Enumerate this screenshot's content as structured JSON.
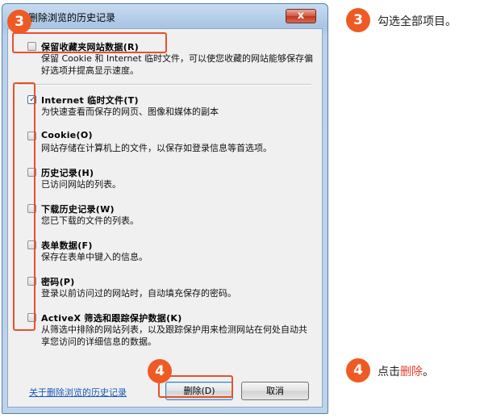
{
  "dialog": {
    "title": "删除浏览的历史记录",
    "close_label": "x",
    "items": [
      {
        "label": "保留收藏夹网站数据(R)",
        "desc": "保留 Cookie 和 Internet 临时文件，可以使您收藏的网站能够保存偏好选项并提高显示速度。",
        "checked": false
      },
      {
        "label": "Internet 临时文件(T)",
        "desc": "为快速查看而保存的网页、图像和媒体的副本",
        "checked": true
      },
      {
        "label": "Cookie(O)",
        "desc": "网站存储在计算机上的文件，以保存如登录信息等首选项。",
        "checked": false
      },
      {
        "label": "历史记录(H)",
        "desc": "已访问网站的列表。",
        "checked": false
      },
      {
        "label": "下载历史记录(W)",
        "desc": "您已下载的文件的列表。",
        "checked": false
      },
      {
        "label": "表单数据(F)",
        "desc": "保存在表单中键入的信息。",
        "checked": false
      },
      {
        "label": "密码(P)",
        "desc": "登录以前访问过的网站时，自动填充保存的密码。",
        "checked": false
      },
      {
        "label": "ActiveX 筛选和跟踪保护数据(K)",
        "desc": "从筛选中排除的网站列表，以及跟踪保护用来检测网站在何处自动共享您访问的详细信息的数据。",
        "checked": false
      }
    ],
    "link": "关于删除浏览的历史记录",
    "delete_label": "删除(D)",
    "cancel_label": "取消"
  },
  "annotations": {
    "step3_number": "3",
    "step3_text": "勾选全部项目。",
    "step4_number": "4",
    "step4_prefix": "点击",
    "step4_accent": "删除",
    "step4_suffix": "。"
  },
  "colors": {
    "accent": "#ef5a24",
    "highlight": "#e8502d",
    "link": "#1a56b8"
  }
}
